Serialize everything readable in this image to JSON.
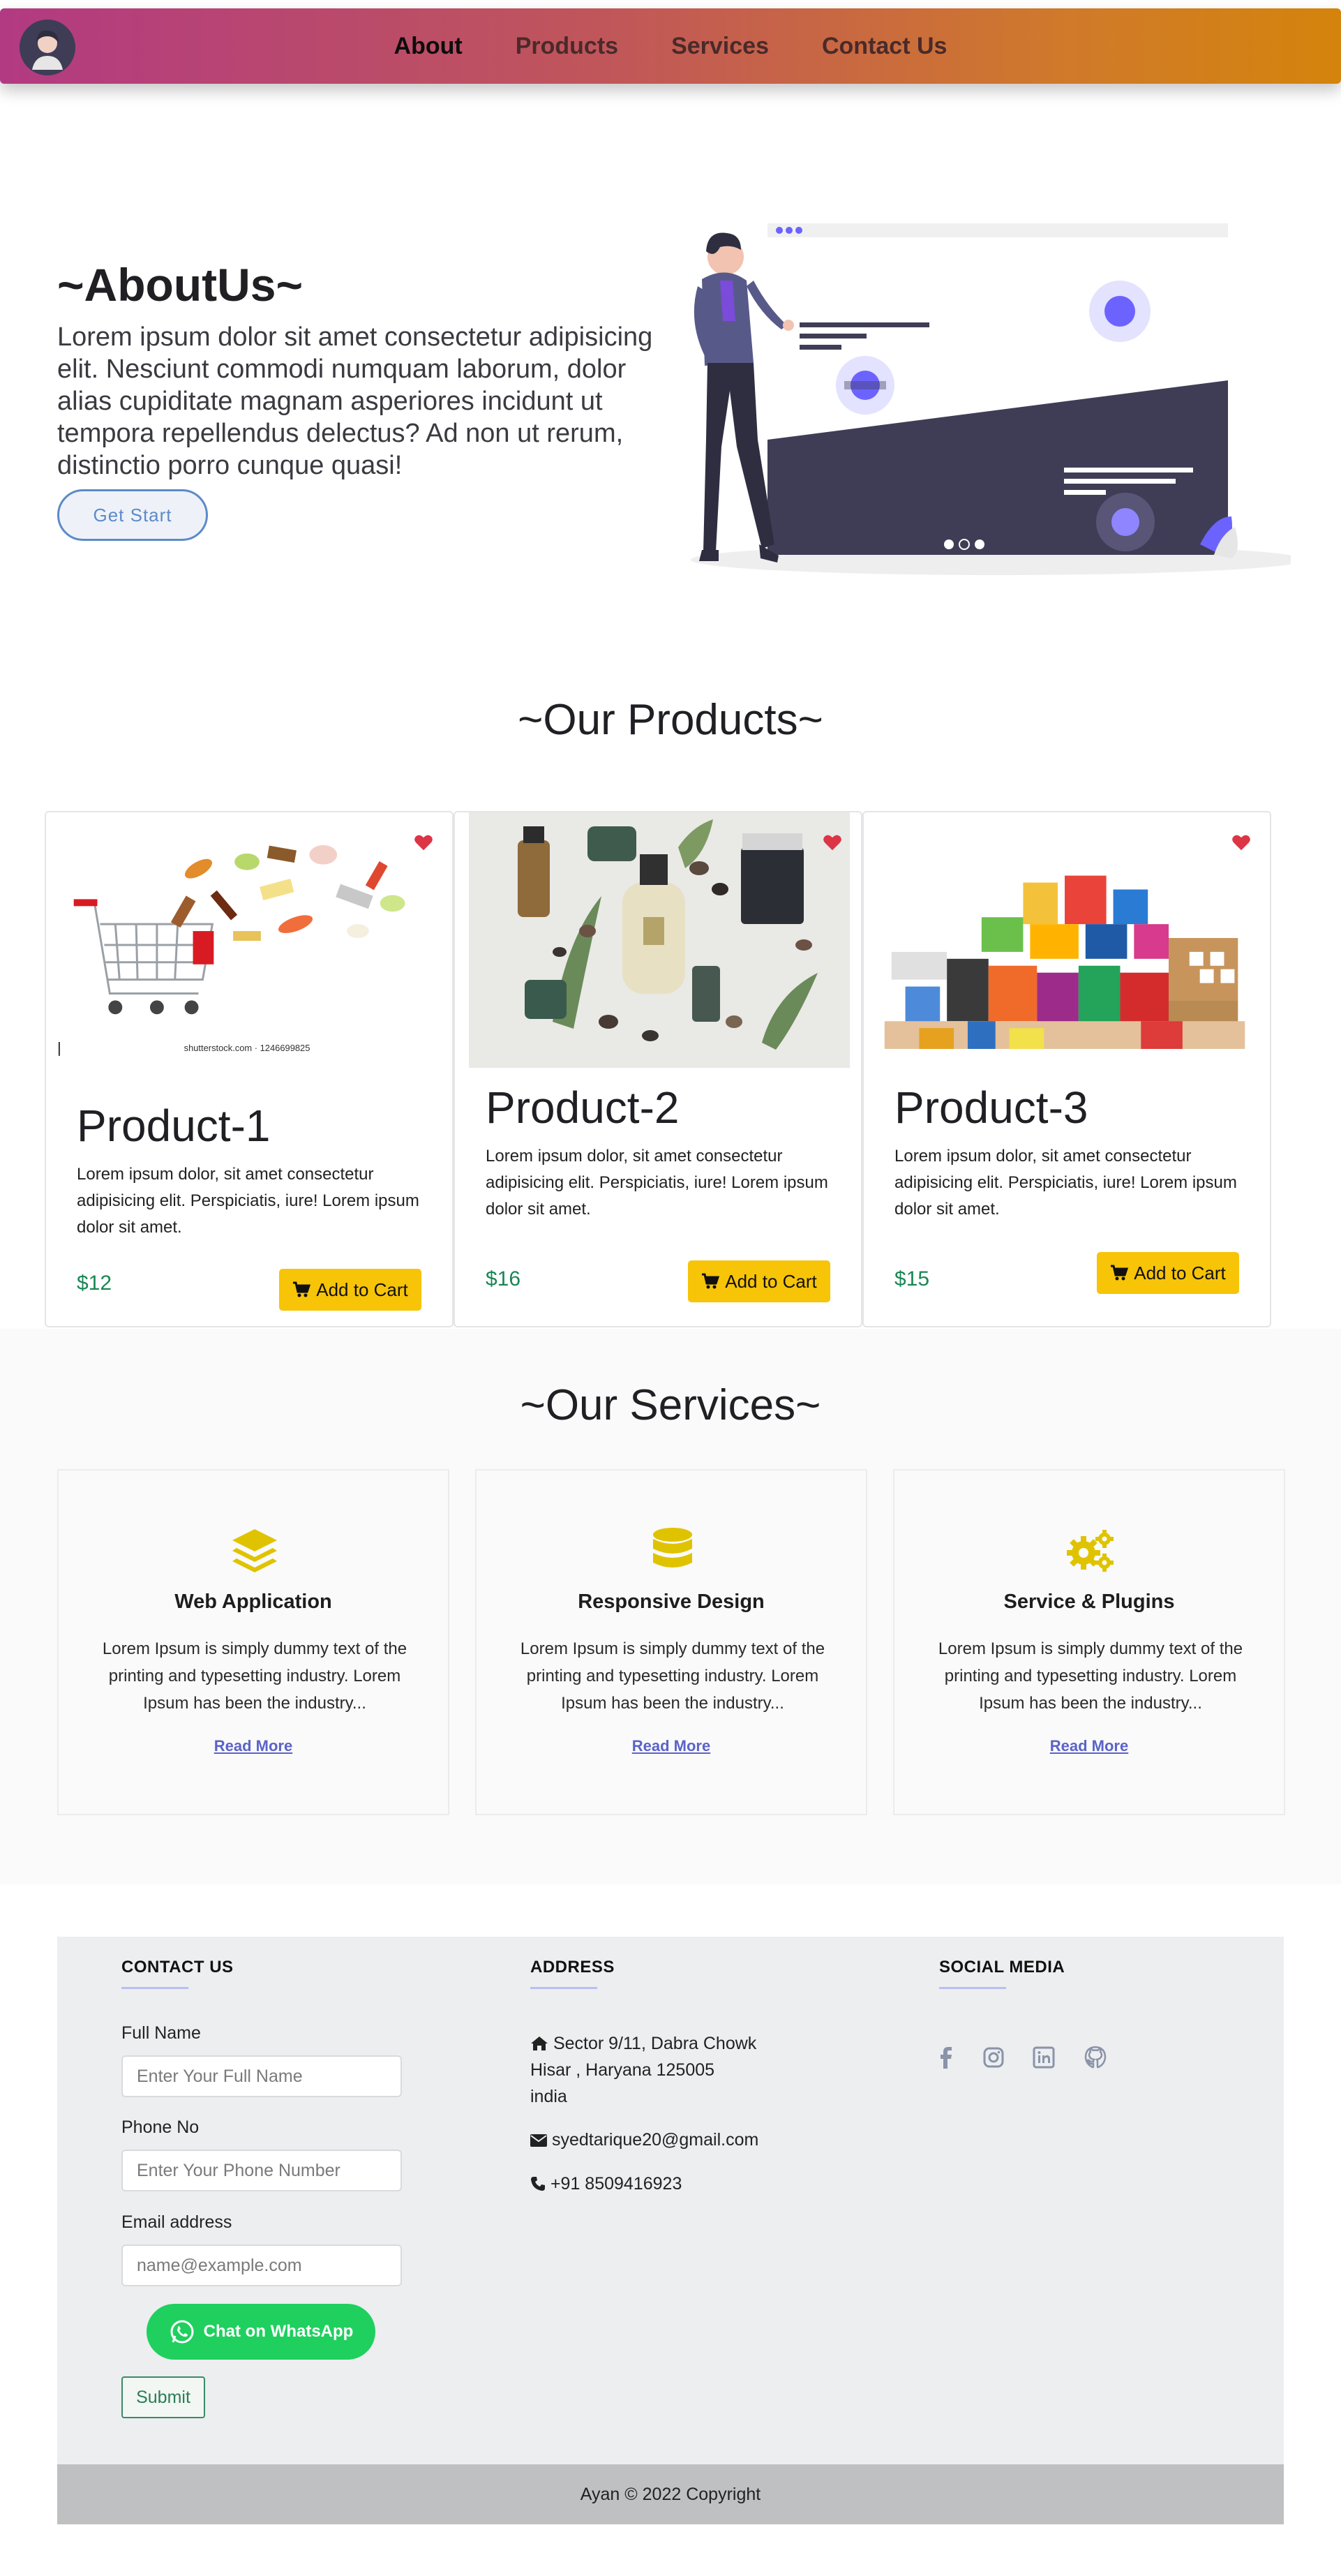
{
  "nav": {
    "links": [
      "About",
      "Products",
      "Services",
      "Contact Us"
    ],
    "active": "About"
  },
  "about": {
    "title": "~AboutUs~",
    "text": "Lorem ipsum dolor sit amet consectetur adipisicing elit. Nesciunt commodi numquam laborum, dolor alias cupiditate magnam asperiores incidunt ut tempora repellendus delectus? Ad non ut rerum, distinctio porro cunque quasi!",
    "button": "Get Start"
  },
  "products": {
    "title": "~Our Products~",
    "items": [
      {
        "name": "Product-1",
        "desc": "Lorem ipsum dolor, sit amet consectetur adipisicing elit. Perspiciatis, iure! Lorem ipsum dolor sit amet.",
        "price": "$12",
        "cart": "Add to Cart",
        "watermark": "shutterstock.com · 1246699825"
      },
      {
        "name": "Product-2",
        "desc": "Lorem ipsum dolor, sit amet consectetur adipisicing elit. Perspiciatis, iure! Lorem ipsum dolor sit amet.",
        "price": "$16",
        "cart": "Add to Cart"
      },
      {
        "name": "Product-3",
        "desc": "Lorem ipsum dolor, sit amet consectetur adipisicing elit. Perspiciatis, iure! Lorem ipsum dolor sit amet.",
        "price": "$15",
        "cart": "Add to Cart"
      }
    ]
  },
  "services": {
    "title": "~Our Services~",
    "items": [
      {
        "icon": "layers-icon",
        "title": "Web Application",
        "desc": "Lorem Ipsum is simply dummy text of the printing and typesetting industry. Lorem Ipsum has been the industry...",
        "link": "Read More"
      },
      {
        "icon": "database-icon",
        "title": "Responsive Design",
        "desc": "Lorem Ipsum is simply dummy text of the printing and typesetting industry. Lorem Ipsum has been the industry...",
        "link": "Read More"
      },
      {
        "icon": "gears-icon",
        "title": "Service & Plugins",
        "desc": "Lorem Ipsum is simply dummy text of the printing and typesetting industry. Lorem Ipsum has been the industry...",
        "link": "Read More"
      }
    ]
  },
  "contact": {
    "heading": "CONTACT US",
    "name_label": "Full Name",
    "name_placeholder": "Enter Your Full Name",
    "phone_label": "Phone No",
    "phone_placeholder": "Enter Your Phone Number",
    "email_label": "Email address",
    "email_placeholder": "name@example.com",
    "whatsapp": "Chat on WhatsApp",
    "submit": "Submit"
  },
  "address": {
    "heading": "ADDRESS",
    "line1": "Sector 9/11, Dabra Chowk",
    "line2": "Hisar , Haryana 125005",
    "line3": "india",
    "email": "syedtarique20@gmail.com",
    "phone": "+91 8509416923"
  },
  "social": {
    "heading": "SOCIAL MEDIA",
    "icons": [
      "facebook-icon",
      "instagram-icon",
      "linkedin-icon",
      "github-icon"
    ]
  },
  "colors": {
    "accent_yellow": "#f7c407",
    "price_green": "#198754",
    "link_purple": "#5b63c9",
    "heart_red": "#dc3545",
    "whatsapp_green": "#1fd05f"
  },
  "footer": {
    "copyright": "Ayan © 2022 Copyright"
  }
}
